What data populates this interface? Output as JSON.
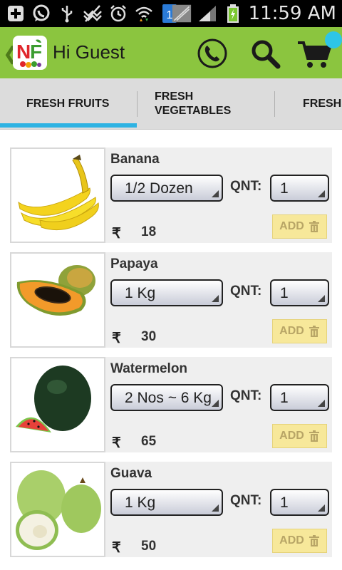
{
  "status_bar": {
    "time": "11:59 AM",
    "sim_badge": "1",
    "icons": [
      "add-icon",
      "whatsapp-icon",
      "usb-icon",
      "signal-blocked-icon",
      "alarm-icon",
      "wifi-icon",
      "sim-icon",
      "no-signal-icon",
      "signal-icon",
      "battery-charging-icon"
    ]
  },
  "action_bar": {
    "logo_text": "NF",
    "title": "Hi Guest",
    "icons": [
      "phone-icon",
      "search-icon",
      "cart-icon"
    ],
    "accent_color": "#8bc53f",
    "badge_color": "#2ec5e6"
  },
  "tabs": [
    {
      "label_line1": "FRESH FRUITS",
      "label_line2": "",
      "selected": true
    },
    {
      "label_line1": "FRESH",
      "label_line2": "VEGETABLES",
      "selected": false
    },
    {
      "label_line1": "FRESH",
      "label_line2": "",
      "selected": false
    }
  ],
  "tab_indicator_color": "#2eb3e3",
  "products": [
    {
      "name": "Banana",
      "unit": "1/2 Dozen",
      "qnt_label": "QNT:",
      "qnt": "1",
      "currency": "₹",
      "price": "18",
      "add_label": "ADD",
      "image": "banana"
    },
    {
      "name": "Papaya",
      "unit": "1 Kg",
      "qnt_label": "QNT:",
      "qnt": "1",
      "currency": "₹",
      "price": "30",
      "add_label": "ADD",
      "image": "papaya"
    },
    {
      "name": "Watermelon",
      "unit": "2 Nos ~ 6 Kg",
      "qnt_label": "QNT:",
      "qnt": "1",
      "currency": "₹",
      "price": "65",
      "add_label": "ADD",
      "image": "watermelon"
    },
    {
      "name": "Guava",
      "unit": "1 Kg",
      "qnt_label": "QNT:",
      "qnt": "1",
      "currency": "₹",
      "price": "50",
      "add_label": "ADD",
      "image": "guava"
    }
  ]
}
